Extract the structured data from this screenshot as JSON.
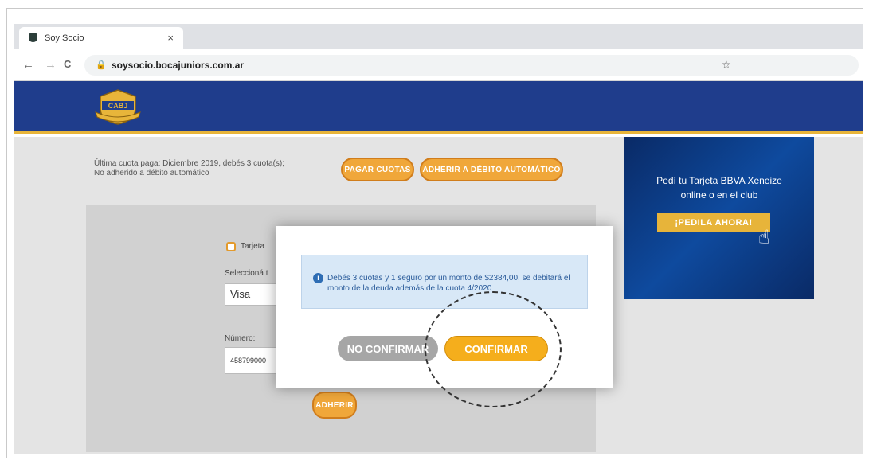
{
  "browser": {
    "tab_title": "Soy Socio",
    "tab_close": "×",
    "back": "←",
    "forward": "→",
    "reload": "C",
    "url": "soysocio.bocajuniors.com.ar",
    "bookmark": "☆"
  },
  "site": {
    "logo_text": "CABJ",
    "status_line1": "Última cuota paga: Diciembre 2019, debés 3 cuota(s);",
    "status_line2": "No adherido a débito automático",
    "pay_button": "PAGAR CUOTAS",
    "debit_button": "ADHERIR A DÉBITO AUTOMÁTICO"
  },
  "form": {
    "card_label": "Tarjeta",
    "select_label": "Seleccioná t",
    "select_value": "Visa",
    "number_label": "Número:",
    "number_value": "458799000",
    "submit_button": "ADHERIR"
  },
  "banner": {
    "line1": "Pedí tu Tarjeta BBVA Xeneize",
    "line2": "online o en el club",
    "cta": "¡PEDILA AHORA!"
  },
  "modal": {
    "message": "Debés 3 cuotas y 1 seguro por un monto de $2384,00, se debitará el monto de la deuda además de la cuota 4/2020",
    "cancel_button": "NO CONFIRMAR",
    "confirm_button": "CONFIRMAR"
  },
  "colors": {
    "header_blue": "#1f3d8c",
    "accent_gold": "#f5ae1c",
    "alert_bg": "#d8e8f7"
  }
}
